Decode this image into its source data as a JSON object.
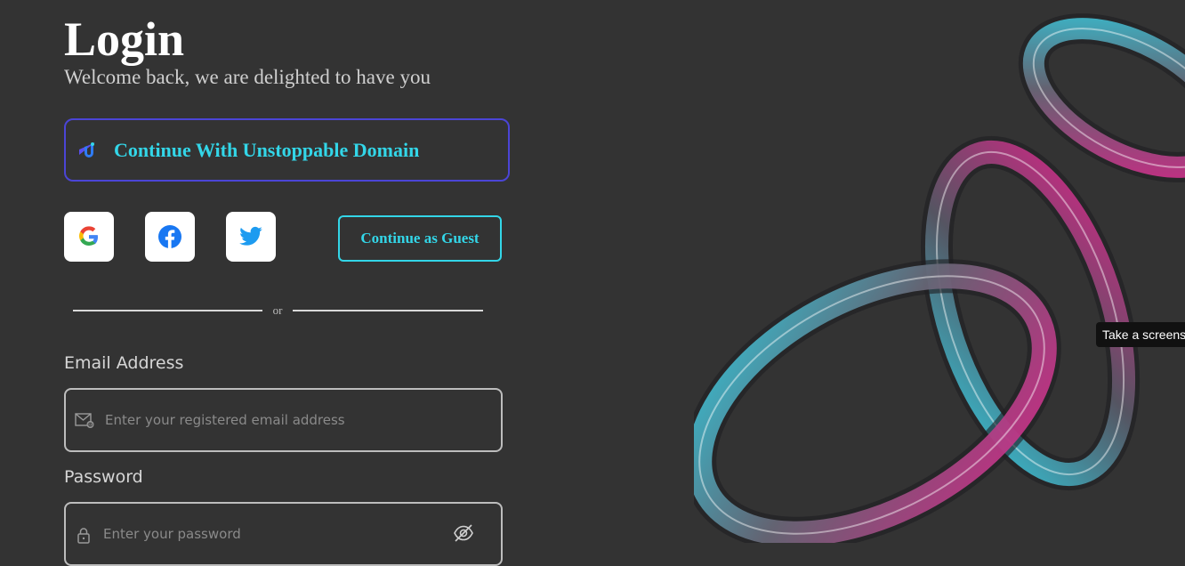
{
  "header": {
    "title": "Login",
    "subtitle": "Welcome back, we are delighted to have you"
  },
  "unstoppable": {
    "label": "Continue With Unstoppable Domain"
  },
  "social": [
    {
      "icon": "google-icon"
    },
    {
      "icon": "facebook-icon"
    },
    {
      "icon": "twitter-icon"
    }
  ],
  "guest": {
    "label": "Continue as Guest"
  },
  "divider": {
    "text": "or"
  },
  "email": {
    "label": "Email Address",
    "placeholder": "Enter your registered email address",
    "icon": "mail-icon"
  },
  "password": {
    "label": "Password",
    "placeholder": "Enter your password",
    "icon": "lock-icon",
    "toggle_icon": "eye-off-icon"
  },
  "tooltip": {
    "text": "Take a screenshot"
  },
  "colors": {
    "background": "#333333",
    "accent_cyan": "#33d6e8",
    "accent_purple": "#4b45d6"
  }
}
